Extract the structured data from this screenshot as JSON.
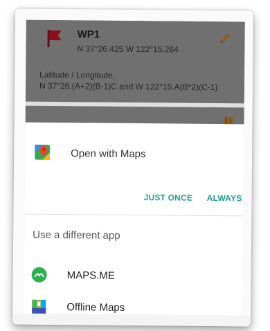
{
  "waypoint": {
    "name": "WP1",
    "coords": "N 37°26.425 W 122°15.264",
    "label": "Latitude / Longitude,",
    "formula": "N 37°26.(A+2)(B-1)C and W 122°15.A(B*2)(C-1)",
    "flag_icon": "flag-icon",
    "edit_icon": "pencil-icon",
    "map_icon": "map-icon"
  },
  "chooser": {
    "open_with": "Open with Maps",
    "open_with_icon": "google-maps-icon",
    "just_once": "JUST ONCE",
    "always": "ALWAYS",
    "different_app": "Use a different app",
    "apps": [
      {
        "name": "MAPS.ME",
        "icon": "mapsme-icon"
      },
      {
        "name": "Offline Maps",
        "icon": "offline-maps-icon"
      }
    ]
  },
  "colors": {
    "accent": "#1aa18f",
    "flag": "#b01020",
    "edit": "#c98a2e"
  }
}
